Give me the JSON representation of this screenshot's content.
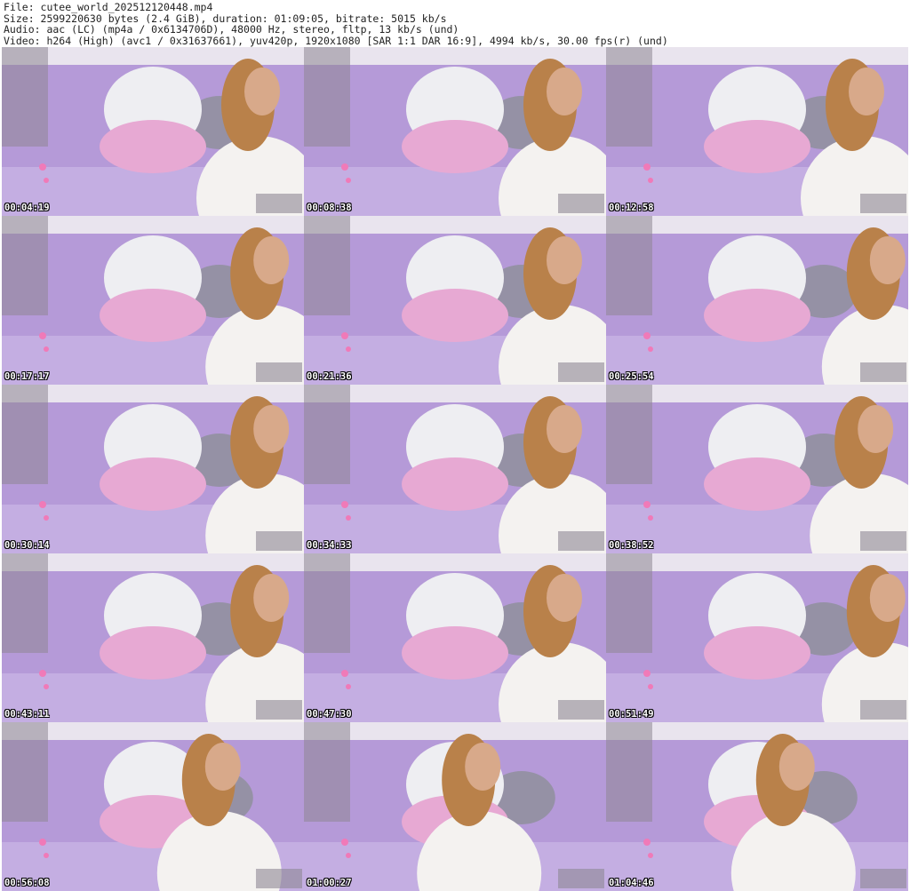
{
  "header": {
    "file_line": "File: cutee_world_202512120448.mp4",
    "size_line": "Size: 2599220630 bytes (2.4 GiB), duration: 01:09:05, bitrate: 5015 kb/s",
    "audio_line": "Audio: aac (LC) (mp4a / 0x6134706D), 48000 Hz, stereo, fltp, 13 kb/s (und)",
    "video_line": "Video: h264 (High) (avc1 / 0x31637661), yuv420p, 1920x1080 [SAR 1:1 DAR 16:9], 4994 kb/s, 30.00 fps(r) (und)"
  },
  "thumbnails": [
    {
      "timestamp": "00:04:19",
      "subject_x": 0.85
    },
    {
      "timestamp": "00:08:38",
      "subject_x": 0.85
    },
    {
      "timestamp": "00:12:58",
      "subject_x": 0.85
    },
    {
      "timestamp": "00:17:17",
      "subject_x": 0.88
    },
    {
      "timestamp": "00:21:36",
      "subject_x": 0.85
    },
    {
      "timestamp": "00:25:54",
      "subject_x": 0.92
    },
    {
      "timestamp": "00:30:14",
      "subject_x": 0.88
    },
    {
      "timestamp": "00:34:33",
      "subject_x": 0.85
    },
    {
      "timestamp": "00:38:52",
      "subject_x": 0.88
    },
    {
      "timestamp": "00:43:11",
      "subject_x": 0.88
    },
    {
      "timestamp": "00:47:30",
      "subject_x": 0.85
    },
    {
      "timestamp": "00:51:49",
      "subject_x": 0.92
    },
    {
      "timestamp": "00:56:08",
      "subject_x": 0.72
    },
    {
      "timestamp": "01:00:27",
      "subject_x": 0.58
    },
    {
      "timestamp": "01:04:46",
      "subject_x": 0.62
    }
  ],
  "colors": {
    "wall": "#e9e4ee",
    "couch": "#b59ad8",
    "couch_light": "#c9b4e6",
    "pillow_white": "#eeeef2",
    "pillow_pink": "#e7a9d3",
    "grey_pillow": "#8f8f9c",
    "sweater": "#f4f2f0",
    "hair": "#b9814a",
    "skin": "#d8a98a",
    "overlay": "#8e8794"
  }
}
